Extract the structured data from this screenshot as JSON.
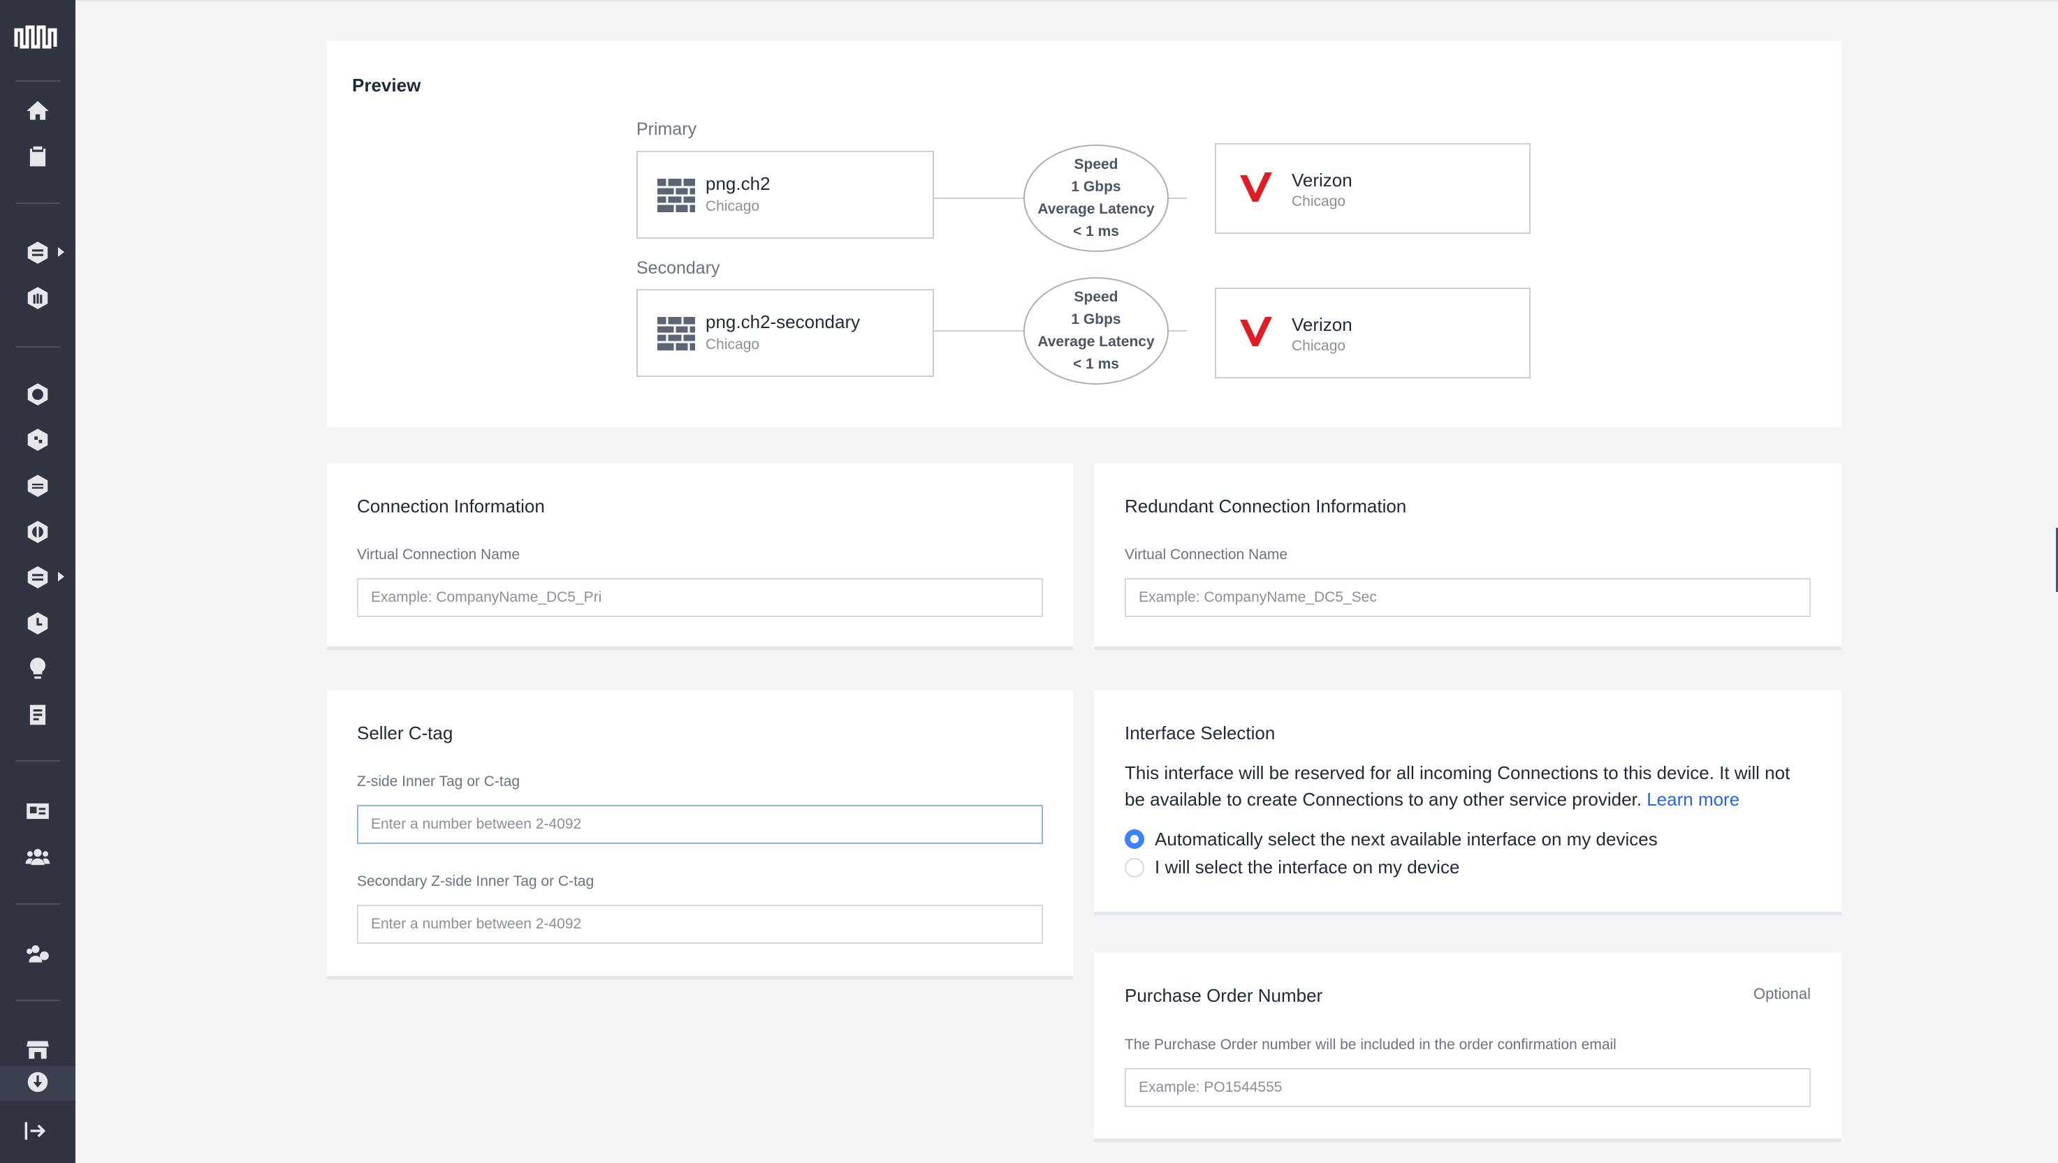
{
  "preview": {
    "title": "Preview",
    "primary": {
      "label": "Primary",
      "device_name": "png.ch2",
      "device_location": "Chicago",
      "speed_label": "Speed",
      "speed_value": "1 Gbps",
      "latency_label": "Average Latency",
      "latency_value": "< 1 ms",
      "provider_name": "Verizon",
      "provider_location": "Chicago"
    },
    "secondary": {
      "label": "Secondary",
      "device_name": "png.ch2-secondary",
      "device_location": "Chicago",
      "speed_label": "Speed",
      "speed_value": "1 Gbps",
      "latency_label": "Average Latency",
      "latency_value": "< 1 ms",
      "provider_name": "Verizon",
      "provider_location": "Chicago"
    }
  },
  "connection_info": {
    "title": "Connection Information",
    "name_label": "Virtual Connection Name",
    "name_placeholder": "Example: CompanyName_DC5_Pri",
    "name_value": ""
  },
  "redundant_info": {
    "title": "Redundant Connection Information",
    "name_label": "Virtual Connection Name",
    "name_placeholder": "Example: CompanyName_DC5_Sec",
    "name_value": ""
  },
  "seller_ctag": {
    "title": "Seller C-tag",
    "primary_label": "Z-side Inner Tag or C-tag",
    "primary_placeholder": "Enter a number between 2-4092",
    "secondary_label": "Secondary Z-side Inner Tag or C-tag",
    "secondary_placeholder": "Enter a number between 2-4092"
  },
  "interface_selection": {
    "title": "Interface Selection",
    "description": "This interface will be reserved for all incoming Connections to this device. It will not be available to create Connections to any other service provider.",
    "learn_more": "Learn more",
    "options": [
      {
        "label": "Automatically select the next available interface on my devices",
        "selected": true
      },
      {
        "label": "I will select the interface on my device",
        "selected": false
      }
    ]
  },
  "purchase_order": {
    "title": "Purchase Order Number",
    "optional_label": "Optional",
    "description": "The Purchase Order number will be included in the order confirmation email",
    "placeholder": "Example: PO1544555"
  },
  "sidebar": {
    "icons": [
      "logo-icon",
      "home-icon",
      "clipboard-icon",
      "layers-icon",
      "building-icon",
      "network-hex-icon",
      "share-hex-icon",
      "stack-hex-icon",
      "globe-hex-icon",
      "exchange-hex-icon",
      "clock-icon",
      "lightbulb-icon",
      "document-icon",
      "id-card-icon",
      "users-icon",
      "team-icon",
      "store-icon",
      "download-icon",
      "logout-icon"
    ]
  },
  "colors": {
    "sidebar_bg": "#2f3440",
    "accent": "#3b82f6",
    "verizon_red": "#e11d24",
    "link": "#2563eb"
  }
}
